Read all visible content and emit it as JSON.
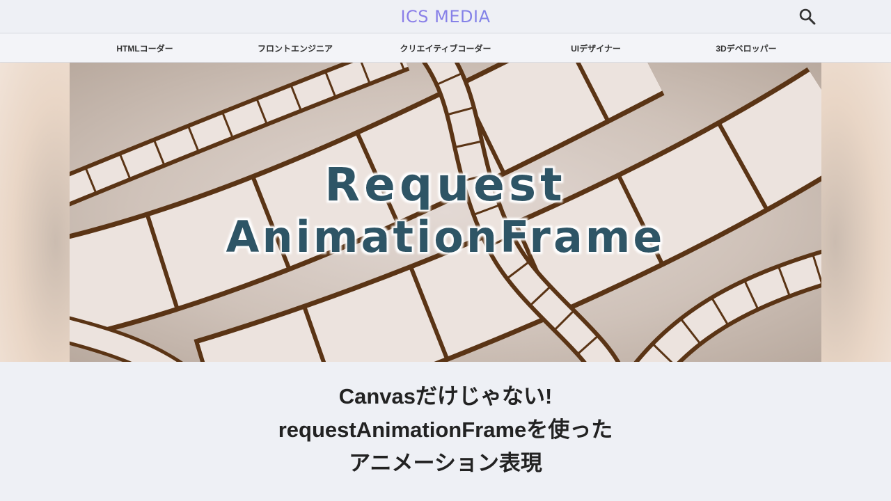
{
  "header": {
    "logo": "ICS MEDIA",
    "search_icon": "search-icon"
  },
  "categories": [
    {
      "label": "HTMLコーダー"
    },
    {
      "label": "フロントエンジニア"
    },
    {
      "label": "クリエイティブコーダー"
    },
    {
      "label": "UIデザイナー"
    },
    {
      "label": "3Dデベロッパー"
    }
  ],
  "hero": {
    "line1": "Request",
    "line2": "AnimationFrame",
    "colors": {
      "text": "#2f5566",
      "film": "#5a3415",
      "film_frame": "#ebe1dc",
      "background": "#c9b9ae"
    }
  },
  "article": {
    "title_lines": [
      "Canvasだけじゃない!",
      "requestAnimationFrameを使った",
      "アニメーション表現"
    ]
  }
}
